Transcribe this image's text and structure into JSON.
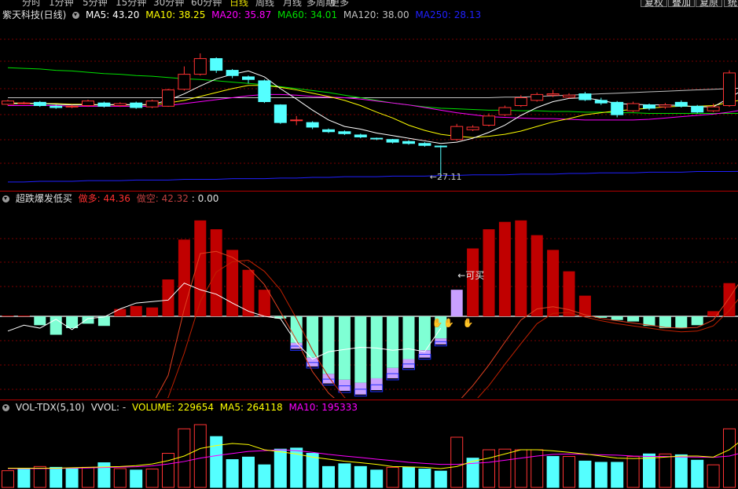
{
  "periods": [
    {
      "label": "分时",
      "active": false
    },
    {
      "label": "1分钟",
      "active": false
    },
    {
      "label": "5分钟",
      "active": false
    },
    {
      "label": "15分钟",
      "active": false
    },
    {
      "label": "30分钟",
      "active": false
    },
    {
      "label": "60分钟",
      "active": false
    },
    {
      "label": "日线",
      "active": true
    },
    {
      "label": "周线",
      "active": false
    },
    {
      "label": "月线",
      "active": false
    },
    {
      "label": "多周期",
      "active": false
    },
    {
      "label": "更多",
      "active": false
    }
  ],
  "toolbar": {
    "replay": "复权",
    "overlay": "叠加",
    "restore": "复原",
    "more": "统"
  },
  "price_panel": {
    "title": "紫天科技(日线)",
    "ma5": "MA5: 43.20",
    "ma10": "MA10: 38.25",
    "ma20": "MA20: 35.87",
    "ma60": "MA60: 34.01",
    "ma120": "MA120: 38.00",
    "ma250": "MA250: 28.13",
    "low_marker": "←27.11"
  },
  "indicator_panel": {
    "title": "超跌爆发低买",
    "up_label": "做多: 44.36",
    "short_label": "做空: 42.32",
    "extra": ": 0.00",
    "buy_marker": "←可买"
  },
  "volume_panel": {
    "title": "VOL-TDX(5,10)",
    "vvol": "VVOL: -",
    "volume": "VOLUME: 229654",
    "ma5": "MA5: 264118",
    "ma10": "MA10: 195333"
  },
  "colors": {
    "up": "#ff3232",
    "down": "#54ffff",
    "ma5": "#ffffff",
    "ma10": "#ffff00",
    "ma20": "#ff00ff",
    "ma60": "#00e000",
    "ma120": "#c0c0c0",
    "ma250": "#2020ff",
    "bull": "#c00000",
    "bear": "#7fffd4",
    "lavender": "#c9a0ff"
  },
  "chart_data": [
    {
      "type": "candlestick",
      "title": "紫天科技(日线)",
      "candles": [
        {
          "o": 38.4,
          "c": 38.9,
          "h": 39.1,
          "l": 38.2
        },
        {
          "o": 38.6,
          "c": 38.6,
          "h": 38.8,
          "l": 38.4
        },
        {
          "o": 38.7,
          "c": 38.2,
          "h": 38.9,
          "l": 38.0
        },
        {
          "o": 38.1,
          "c": 37.9,
          "h": 38.3,
          "l": 37.7
        },
        {
          "o": 38.0,
          "c": 38.1,
          "h": 38.3,
          "l": 37.8
        },
        {
          "o": 38.2,
          "c": 38.9,
          "h": 39.1,
          "l": 38.0
        },
        {
          "o": 38.6,
          "c": 38.1,
          "h": 38.8,
          "l": 37.9
        },
        {
          "o": 38.2,
          "c": 38.5,
          "h": 38.7,
          "l": 38.0
        },
        {
          "o": 38.6,
          "c": 37.9,
          "h": 38.8,
          "l": 37.7
        },
        {
          "o": 38.0,
          "c": 38.9,
          "h": 39.1,
          "l": 37.8
        },
        {
          "o": 38.1,
          "c": 40.6,
          "h": 40.8,
          "l": 38.0
        },
        {
          "o": 40.7,
          "c": 43.0,
          "h": 44.2,
          "l": 40.5
        },
        {
          "o": 43.0,
          "c": 45.4,
          "h": 46.2,
          "l": 42.8
        },
        {
          "o": 45.4,
          "c": 43.6,
          "h": 45.6,
          "l": 43.2
        },
        {
          "o": 43.6,
          "c": 42.8,
          "h": 43.8,
          "l": 42.4
        },
        {
          "o": 42.6,
          "c": 42.2,
          "h": 42.8,
          "l": 41.6
        },
        {
          "o": 42.0,
          "c": 38.8,
          "h": 42.2,
          "l": 38.6
        },
        {
          "o": 38.3,
          "c": 35.6,
          "h": 38.4,
          "l": 35.4
        },
        {
          "o": 35.9,
          "c": 36.0,
          "h": 36.6,
          "l": 35.2
        },
        {
          "o": 35.6,
          "c": 34.9,
          "h": 35.8,
          "l": 34.6
        },
        {
          "o": 34.5,
          "c": 34.2,
          "h": 34.7,
          "l": 34.0
        },
        {
          "o": 34.2,
          "c": 33.9,
          "h": 34.4,
          "l": 33.7
        },
        {
          "o": 33.7,
          "c": 33.4,
          "h": 33.9,
          "l": 33.2
        },
        {
          "o": 33.2,
          "c": 33.1,
          "h": 33.3,
          "l": 32.9
        },
        {
          "o": 33.0,
          "c": 32.6,
          "h": 33.1,
          "l": 32.4
        },
        {
          "o": 32.7,
          "c": 32.4,
          "h": 32.9,
          "l": 32.2
        },
        {
          "o": 32.4,
          "c": 32.1,
          "h": 32.6,
          "l": 31.9
        },
        {
          "o": 32.0,
          "c": 31.9,
          "h": 32.1,
          "l": 27.11
        },
        {
          "o": 33.0,
          "c": 35.0,
          "h": 35.4,
          "l": 32.8
        },
        {
          "o": 34.5,
          "c": 34.9,
          "h": 35.2,
          "l": 34.3
        },
        {
          "o": 35.2,
          "c": 36.6,
          "h": 37.0,
          "l": 35.0
        },
        {
          "o": 36.8,
          "c": 37.9,
          "h": 38.2,
          "l": 36.6
        },
        {
          "o": 38.2,
          "c": 39.4,
          "h": 39.8,
          "l": 38.0
        },
        {
          "o": 39.0,
          "c": 39.9,
          "h": 40.2,
          "l": 38.8
        },
        {
          "o": 39.8,
          "c": 40.0,
          "h": 40.6,
          "l": 39.5
        },
        {
          "o": 39.5,
          "c": 39.8,
          "h": 40.1,
          "l": 39.3
        },
        {
          "o": 40.0,
          "c": 39.1,
          "h": 40.3,
          "l": 38.9
        },
        {
          "o": 39.0,
          "c": 38.6,
          "h": 39.4,
          "l": 38.3
        },
        {
          "o": 38.7,
          "c": 36.8,
          "h": 38.9,
          "l": 36.4
        },
        {
          "o": 37.4,
          "c": 38.5,
          "h": 38.8,
          "l": 37.2
        },
        {
          "o": 38.3,
          "c": 37.8,
          "h": 38.5,
          "l": 37.5
        },
        {
          "o": 38.0,
          "c": 38.3,
          "h": 38.6,
          "l": 37.7
        },
        {
          "o": 38.7,
          "c": 38.1,
          "h": 39.0,
          "l": 37.9
        },
        {
          "o": 38.1,
          "c": 37.2,
          "h": 38.3,
          "l": 37.0
        },
        {
          "o": 37.4,
          "c": 38.0,
          "h": 38.5,
          "l": 37.2
        },
        {
          "o": 38.2,
          "c": 43.2,
          "h": 43.6,
          "l": 38.0
        },
        {
          "o": 43.0,
          "c": 43.2,
          "h": 44.6,
          "l": 41.6
        }
      ],
      "ma5": [
        38.5,
        38.5,
        38.5,
        38.4,
        38.3,
        38.3,
        38.3,
        38.4,
        38.3,
        38.4,
        39.0,
        40.0,
        41.2,
        42.3,
        43.0,
        43.5,
        42.6,
        40.8,
        39.2,
        37.5,
        36.0,
        35.0,
        34.6,
        34.0,
        33.6,
        33.2,
        32.8,
        32.4,
        32.6,
        33.2,
        34.1,
        35.2,
        36.7,
        37.9,
        38.8,
        39.3,
        39.4,
        39.0,
        38.5,
        38.4,
        38.3,
        38.3,
        38.2,
        38.0,
        38.0,
        39.4,
        40.8
      ],
      "ma10": [
        38.6,
        38.6,
        38.5,
        38.5,
        38.4,
        38.4,
        38.3,
        38.3,
        38.3,
        38.3,
        38.6,
        39.0,
        39.6,
        40.2,
        40.8,
        41.3,
        41.3,
        41.0,
        40.6,
        40.1,
        39.6,
        39.0,
        38.2,
        37.2,
        36.3,
        35.2,
        34.4,
        33.8,
        33.5,
        33.3,
        33.5,
        33.8,
        34.3,
        35.0,
        35.7,
        36.2,
        36.8,
        37.1,
        37.4,
        37.6,
        37.8,
        38.0,
        38.1,
        38.1,
        38.2,
        38.7,
        39.2
      ],
      "ma20": [
        38.2,
        38.2,
        38.2,
        38.2,
        38.1,
        38.1,
        38.1,
        38.1,
        38.1,
        38.1,
        38.2,
        38.5,
        38.8,
        39.1,
        39.4,
        39.7,
        39.9,
        39.9,
        39.8,
        39.6,
        39.5,
        39.4,
        39.2,
        38.9,
        38.6,
        38.3,
        37.9,
        37.5,
        37.1,
        36.8,
        36.5,
        36.4,
        36.3,
        36.2,
        36.2,
        36.1,
        36.0,
        36.0,
        36.0,
        36.0,
        36.1,
        36.3,
        36.5,
        36.7,
        36.9,
        37.2,
        37.6
      ],
      "ma60": [
        44.0,
        43.9,
        43.8,
        43.6,
        43.5,
        43.3,
        43.1,
        43.0,
        42.8,
        42.7,
        42.5,
        42.3,
        42.2,
        42.0,
        41.8,
        41.6,
        41.4,
        41.1,
        40.8,
        40.5,
        40.2,
        39.8,
        39.4,
        39.0,
        38.6,
        38.3,
        38.0,
        37.8,
        37.7,
        37.6,
        37.5,
        37.5,
        37.4,
        37.4,
        37.3,
        37.3,
        37.2,
        37.2,
        37.1,
        37.1,
        37.0,
        37.0,
        37.0,
        37.0,
        37.0,
        37.0,
        37.0
      ],
      "ma120": [
        39.4,
        39.4,
        39.4,
        39.4,
        39.4,
        39.4,
        39.4,
        39.4,
        39.4,
        39.4,
        39.4,
        39.4,
        39.4,
        39.4,
        39.4,
        39.4,
        39.4,
        39.4,
        39.4,
        39.4,
        39.4,
        39.4,
        39.4,
        39.4,
        39.4,
        39.4,
        39.4,
        39.4,
        39.4,
        39.4,
        39.4,
        39.5,
        39.5,
        39.6,
        39.7,
        39.8,
        39.9,
        40.0,
        40.1,
        40.2,
        40.3,
        40.4,
        40.5,
        40.6,
        40.7,
        40.8,
        40.9
      ],
      "ma250": [
        26.5,
        26.5,
        26.6,
        26.6,
        26.6,
        26.7,
        26.7,
        26.7,
        26.8,
        26.8,
        26.8,
        26.9,
        26.9,
        26.9,
        27.0,
        27.0,
        27.0,
        27.1,
        27.1,
        27.2,
        27.2,
        27.3,
        27.3,
        27.3,
        27.4,
        27.4,
        27.4,
        27.5,
        27.5,
        27.6,
        27.6,
        27.6,
        27.7,
        27.7,
        27.7,
        27.8,
        27.8,
        27.9,
        27.9,
        27.9,
        28.0,
        28.0,
        28.0,
        28.1,
        28.1,
        28.1,
        28.13
      ]
    },
    {
      "type": "bar",
      "title": "超跌爆发低买",
      "values": [
        0.1,
        0.1,
        -1.2,
        -2.5,
        -1.6,
        -1.0,
        -1.3,
        1.0,
        1.4,
        1.2,
        5.0,
        10.4,
        13.0,
        11.8,
        9.0,
        6.3,
        3.6,
        -0.3,
        -3.6,
        -5.6,
        -7.8,
        -8.6,
        -9.0,
        -8.4,
        -7.0,
        -5.8,
        -4.6,
        -3.0,
        3.6,
        9.2,
        11.8,
        12.8,
        13.0,
        11.0,
        9.0,
        6.1,
        2.8,
        -0.2,
        -0.5,
        -0.7,
        -1.3,
        -1.6,
        -1.6,
        -1.2,
        0.7,
        4.5,
        9.0
      ],
      "lavender_tail": [
        0,
        0,
        0,
        0,
        0,
        0,
        0,
        0,
        0,
        0,
        0,
        0,
        0,
        0,
        0,
        0,
        0,
        0,
        -0.8,
        -1.2,
        -1.3,
        -1.5,
        -1.6,
        -1.6,
        -1.4,
        -1.2,
        -1.0,
        -0.8,
        0,
        0,
        0,
        0,
        0,
        0,
        0,
        0,
        0,
        0,
        0,
        0,
        0,
        0,
        0,
        0,
        0,
        0,
        0
      ],
      "white_line": [
        -2,
        -1.2,
        -1.6,
        -0.4,
        -1.8,
        -0.3,
        -0.1,
        1.0,
        1.8,
        2.0,
        2.2,
        4.5,
        3.6,
        3.0,
        1.8,
        0.7,
        0.0,
        -0.3,
        -3.6,
        -5.8,
        -4.8,
        -4.5,
        -4.2,
        -4.3,
        -4.6,
        -4.4,
        -4.8,
        -1.6,
        0,
        0,
        0,
        0,
        0,
        0,
        0,
        0,
        0,
        0,
        0,
        0,
        0,
        0,
        0,
        0,
        0,
        0,
        0
      ],
      "red_line_1": [
        -12,
        -12,
        -12,
        -12,
        -12,
        -12,
        -12,
        -12,
        -12,
        -12,
        -8,
        1,
        8.5,
        8.8,
        8.0,
        6.6,
        4.3,
        0.6,
        -3.2,
        -7.5,
        -10.4,
        -12.3,
        -13.5,
        -14.6,
        -15.1,
        -15.1,
        -14.6,
        -13.6,
        -11.8,
        -9.4,
        -6.6,
        -3.5,
        -0.5,
        1.0,
        1.3,
        0.9,
        0.2,
        -0.3,
        -0.6,
        -0.9,
        -1.2,
        -1.5,
        -1.6,
        -1.5,
        -0.5,
        2.5,
        5.8
      ],
      "red_line_2": [
        -13,
        -13,
        -13,
        -13,
        -13,
        -13,
        -13,
        -13,
        -13,
        -13,
        -11,
        -5,
        2,
        6.0,
        7.4,
        7.6,
        6.1,
        3.6,
        -0.3,
        -4.6,
        -8.2,
        -11.0,
        -13.0,
        -14.3,
        -15.1,
        -15.5,
        -15.4,
        -14.8,
        -13.7,
        -11.8,
        -9.4,
        -6.5,
        -3.7,
        -1.0,
        0.4,
        0.5,
        -0.1,
        -0.6,
        -1.0,
        -1.3,
        -1.6,
        -1.9,
        -2.1,
        -2.0,
        -1.3,
        0.8,
        3.5
      ],
      "ylim": [
        -16,
        17
      ]
    },
    {
      "type": "bar",
      "title": "VOL-TDX(5,10)",
      "volume": [
        80,
        90,
        100,
        96,
        92,
        96,
        118,
        90,
        83,
        88,
        163,
        280,
        300,
        243,
        133,
        145,
        108,
        183,
        188,
        163,
        100,
        113,
        100,
        83,
        96,
        96,
        88,
        78,
        240,
        140,
        180,
        183,
        180,
        180,
        148,
        148,
        126,
        120,
        120,
        148,
        160,
        160,
        156,
        130,
        108,
        280,
        293
      ],
      "up": [
        true,
        false,
        true,
        false,
        false,
        true,
        false,
        true,
        false,
        true,
        true,
        true,
        true,
        false,
        false,
        false,
        false,
        false,
        false,
        false,
        false,
        false,
        false,
        false,
        true,
        false,
        false,
        false,
        true,
        false,
        true,
        true,
        true,
        true,
        false,
        true,
        false,
        false,
        false,
        true,
        false,
        true,
        false,
        false,
        true,
        true,
        false
      ],
      "ma5": [
        92,
        92,
        92,
        92,
        94,
        96,
        98,
        100,
        104,
        112,
        128,
        150,
        186,
        200,
        210,
        205,
        180,
        170,
        160,
        145,
        135,
        125,
        118,
        110,
        100,
        98,
        96,
        90,
        100,
        125,
        140,
        160,
        180,
        180,
        175,
        168,
        160,
        150,
        140,
        138,
        140,
        145,
        150,
        150,
        145,
        180,
        240
      ],
      "ma10": [
        90,
        90,
        90,
        91,
        92,
        93,
        95,
        97,
        99,
        103,
        112,
        124,
        140,
        152,
        162,
        172,
        176,
        180,
        176,
        168,
        158,
        150,
        143,
        135,
        128,
        120,
        115,
        110,
        110,
        115,
        120,
        130,
        140,
        150,
        158,
        160,
        158,
        156,
        154,
        150,
        148,
        148,
        146,
        145,
        144,
        150,
        170
      ],
      "ylim": [
        0,
        330
      ]
    }
  ]
}
